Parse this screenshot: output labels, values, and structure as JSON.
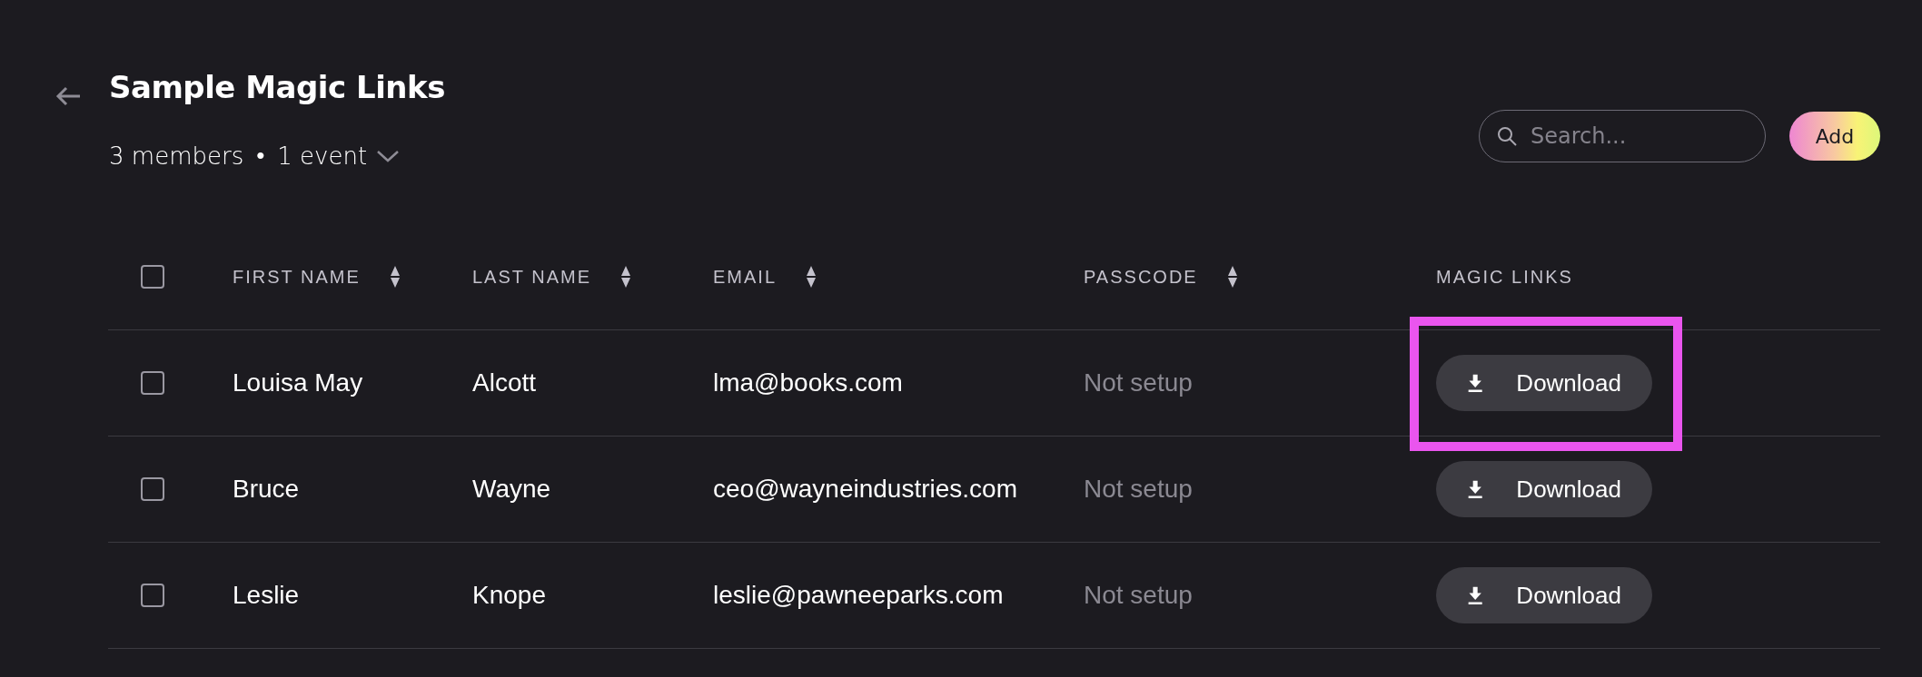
{
  "header": {
    "title": "Sample Magic Links",
    "members": "3 members",
    "separator": "•",
    "events": "1 event"
  },
  "search": {
    "placeholder": "Search..."
  },
  "add_button": "Add",
  "table": {
    "select_all": {
      "checked": false
    },
    "columns": [
      {
        "label": "FIRST NAME",
        "sortable": true
      },
      {
        "label": "LAST NAME",
        "sortable": true
      },
      {
        "label": "EMAIL",
        "sortable": true
      },
      {
        "label": "PASSCODE",
        "sortable": true
      },
      {
        "label": "MAGIC LINKS",
        "sortable": false
      }
    ],
    "rows": [
      {
        "checked": false,
        "first_name": "Louisa May",
        "last_name": "Alcott",
        "email": "lma@books.com",
        "passcode": "Not setup",
        "link": "Download",
        "highlighted": true
      },
      {
        "checked": false,
        "first_name": "Bruce",
        "last_name": "Wayne",
        "email": "ceo@wayneindustries.com",
        "passcode": "Not setup",
        "link": "Download",
        "highlighted": false
      },
      {
        "checked": false,
        "first_name": "Leslie",
        "last_name": "Knope",
        "email": "leslie@pawneeparks.com",
        "passcode": "Not setup",
        "link": "Download",
        "highlighted": false
      }
    ]
  }
}
